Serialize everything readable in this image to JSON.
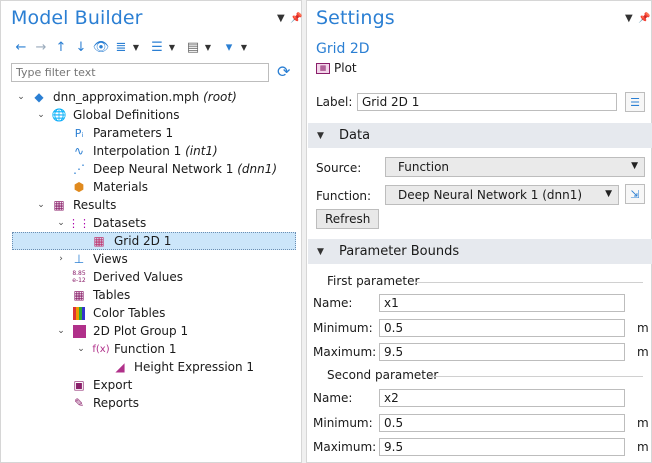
{
  "model_builder": {
    "title": "Model Builder",
    "filter_placeholder": "Type filter text",
    "tree": [
      {
        "label": "dnn_approximation.mph",
        "tag": "(root)"
      },
      {
        "label": "Global Definitions"
      },
      {
        "label": "Parameters 1"
      },
      {
        "label": "Interpolation 1",
        "tag": "(int1)"
      },
      {
        "label": "Deep Neural Network 1",
        "tag": "(dnn1)"
      },
      {
        "label": "Materials"
      },
      {
        "label": "Results"
      },
      {
        "label": "Datasets"
      },
      {
        "label": "Grid 2D 1"
      },
      {
        "label": "Views"
      },
      {
        "label": "Derived Values"
      },
      {
        "label": "Tables"
      },
      {
        "label": "Color Tables"
      },
      {
        "label": "2D Plot Group 1"
      },
      {
        "label": "Function 1"
      },
      {
        "label": "Height Expression 1"
      },
      {
        "label": "Export"
      },
      {
        "label": "Reports"
      }
    ],
    "derived_icon_text": {
      "top": "8.85",
      "bottom": "e-12"
    },
    "function_icon_text": "f(x)"
  },
  "settings": {
    "title": "Settings",
    "subtitle": "Grid 2D",
    "type_label": "Plot",
    "label_field": {
      "label": "Label:",
      "value": "Grid 2D 1"
    },
    "data_section": {
      "title": "Data",
      "source": {
        "label": "Source:",
        "value": "Function"
      },
      "function": {
        "label": "Function:",
        "value": "Deep Neural Network 1 (dnn1)"
      },
      "refresh_button": "Refresh"
    },
    "bounds_section": {
      "title": "Parameter Bounds",
      "first": {
        "heading": "First parameter",
        "name": {
          "label": "Name:",
          "value": "x1"
        },
        "minimum": {
          "label": "Minimum:",
          "value": "0.5",
          "unit": "m"
        },
        "maximum": {
          "label": "Maximum:",
          "value": "9.5",
          "unit": "m"
        }
      },
      "second": {
        "heading": "Second parameter",
        "name": {
          "label": "Name:",
          "value": "x2"
        },
        "minimum": {
          "label": "Minimum:",
          "value": "0.5",
          "unit": "m"
        },
        "maximum": {
          "label": "Maximum:",
          "value": "9.5",
          "unit": "m"
        }
      }
    }
  },
  "colors": {
    "accent": "#2b7fd3",
    "selection": "#cce6fa",
    "section_bg": "#e6e9ee"
  }
}
